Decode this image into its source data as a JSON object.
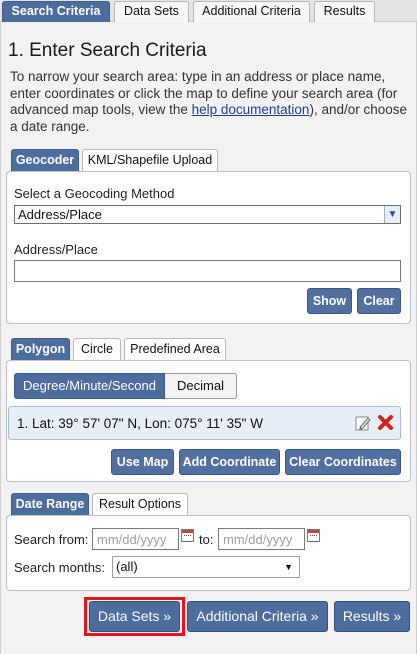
{
  "main_tabs": [
    {
      "label": "Search Criteria",
      "active": true
    },
    {
      "label": "Data Sets",
      "active": false
    },
    {
      "label": "Additional Criteria",
      "active": false
    },
    {
      "label": "Results",
      "active": false
    }
  ],
  "section_title": "1. Enter Search Criteria",
  "intro": {
    "text_before": "To narrow your search area: type in an address or place name, enter coordinates or click the map to define your search area (for advanced map tools, view the ",
    "link": "help documentation",
    "text_after": "), and/or choose a date range."
  },
  "geocoder": {
    "tabs": [
      {
        "label": "Geocoder",
        "active": true
      },
      {
        "label": "KML/Shapefile Upload",
        "active": false
      }
    ],
    "method_label": "Select a Geocoding Method",
    "method_value": "Address/Place",
    "address_label": "Address/Place",
    "address_value": "",
    "show_label": "Show",
    "clear_label": "Clear"
  },
  "area": {
    "tabs": [
      {
        "label": "Polygon",
        "active": true
      },
      {
        "label": "Circle",
        "active": false
      },
      {
        "label": "Predefined Area",
        "active": false
      }
    ],
    "format_on": "Degree/Minute/Second",
    "format_off": "Decimal",
    "coordinates": [
      {
        "text": "1.  Lat: 39° 57' 07\" N, Lon: 075° 11' 35\" W"
      }
    ],
    "use_map_label": "Use Map",
    "add_coordinate_label": "Add Coordinate",
    "clear_coordinates_label": "Clear Coordinates"
  },
  "date": {
    "tabs": [
      {
        "label": "Date Range",
        "active": true
      },
      {
        "label": "Result Options",
        "active": false
      }
    ],
    "from_label": "Search from:",
    "from_placeholder": "mm/dd/yyyy",
    "to_label": "to:",
    "to_placeholder": "mm/dd/yyyy",
    "months_label": "Search months:",
    "months_value": "(all)"
  },
  "nav": {
    "data_sets": "Data Sets »",
    "additional_criteria": "Additional Criteria »",
    "results": "Results »"
  },
  "colors": {
    "accent": "#4d6d9f",
    "highlight": "#e0161b",
    "delete": "#d0231c"
  },
  "icons": {
    "edit": "edit-icon",
    "delete": "delete-icon",
    "calendar": "calendar-icon",
    "dropdown": "chevron-down-icon"
  }
}
